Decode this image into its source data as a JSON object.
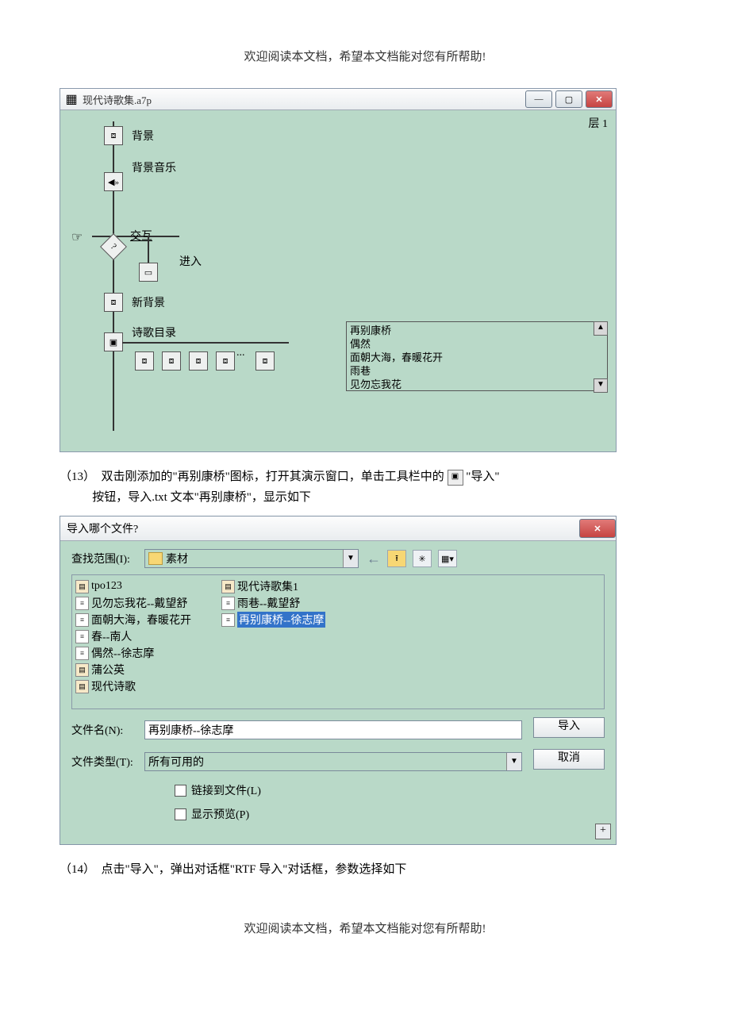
{
  "page": {
    "header": "欢迎阅读本文档，希望本文档能对您有所帮助!",
    "footer": "欢迎阅读本文档，希望本文档能对您有所帮助!"
  },
  "window1": {
    "title": "现代诗歌集.a7p",
    "layer": "层 1",
    "nodes": {
      "bg": "背景",
      "bgm": "背景音乐",
      "interact": "交互",
      "enter": "进入",
      "newbg": "新背景",
      "menu": "诗歌目录"
    },
    "poems": [
      "再别康桥",
      "偶然",
      "面朝大海，春暖花开",
      "雨巷",
      "见勿忘我花"
    ]
  },
  "step13": {
    "num": "（13）",
    "line1": "双击刚添加的\"再别康桥\"图标，打开其演示窗口，单击工具栏中的",
    "line1b": "\"导入\"",
    "line2": "按钮，导入.txt 文本\"再别康桥\"，显示如下"
  },
  "dialog": {
    "title": "导入哪个文件?",
    "lookin_label": "查找范围(I):",
    "lookin_value": "素材",
    "files_col1": [
      {
        "name": "tpo123",
        "type": "folder"
      },
      {
        "name": "见勿忘我花--戴望舒",
        "type": "txt"
      },
      {
        "name": "面朝大海，春暖花开",
        "type": "txt"
      },
      {
        "name": "春--南人",
        "type": "txt"
      },
      {
        "name": "偶然--徐志摩",
        "type": "txt"
      },
      {
        "name": "蒲公英",
        "type": "folder"
      }
    ],
    "files_col2": [
      {
        "name": "现代诗歌",
        "type": "folder"
      },
      {
        "name": "现代诗歌集1",
        "type": "folder"
      },
      {
        "name": "雨巷--戴望舒",
        "type": "txt"
      },
      {
        "name": "再别康桥--徐志摩",
        "type": "txt",
        "selected": true
      }
    ],
    "filename_label": "文件名(N):",
    "filename_value": "再别康桥--徐志摩",
    "filetype_label": "文件类型(T):",
    "filetype_value": "所有可用的",
    "btn_import": "导入",
    "btn_cancel": "取消",
    "chk_link": "链接到文件(L)",
    "chk_preview": "显示预览(P)"
  },
  "step14": {
    "num": "（14）",
    "text": "点击\"导入\"，弹出对话框\"RTF 导入\"对话框，参数选择如下"
  }
}
